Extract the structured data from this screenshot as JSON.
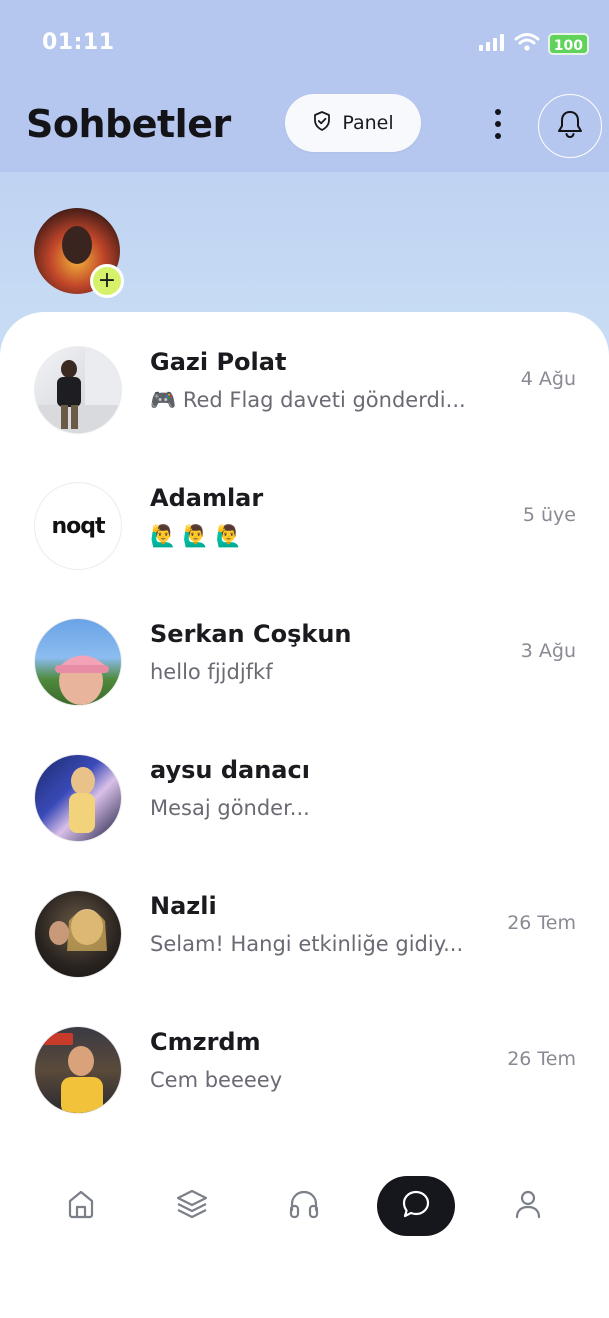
{
  "status_bar": {
    "time": "01:11",
    "battery": "100",
    "icons": [
      "signal-icon",
      "wifi-icon",
      "battery-icon"
    ]
  },
  "header": {
    "title": "Sohbetler",
    "panel_label": "Panel",
    "panel_icon": "shield-check-icon",
    "more_icon": "more-vertical-icon",
    "notifications_icon": "bell-icon"
  },
  "story": {
    "add_symbol": "+",
    "add_color": "#d6f26a"
  },
  "chats": [
    {
      "name": "Gazi Polat",
      "preview": "🎮 Red Flag daveti gönderdi...",
      "meta": "4 Ağu"
    },
    {
      "name": "Adamlar",
      "preview": "🙋‍♂️ 🙋‍♂️ 🙋‍♂️",
      "meta": "5 üye",
      "avatar_text": "noqt"
    },
    {
      "name": "Serkan Coşkun",
      "preview": "hello fjjdjfkf",
      "meta": "3 Ağu"
    },
    {
      "name": "aysu danacı",
      "preview": "Mesaj gönder...",
      "meta": ""
    },
    {
      "name": "Nazli",
      "preview": "Selam! Hangi etkinliğe gidiy...",
      "meta": "26 Tem"
    },
    {
      "name": "Cmzrdm",
      "preview": "Cem beeeey",
      "meta": "26 Tem"
    }
  ],
  "bottom_nav": {
    "items": [
      "home-icon",
      "layers-icon",
      "headphones-icon",
      "chat-icon",
      "profile-icon"
    ],
    "active": "chat-icon"
  },
  "colors": {
    "header_bg": "#b5c7ef",
    "accent_green": "#d6f26a",
    "active_nav": "#15171c"
  }
}
